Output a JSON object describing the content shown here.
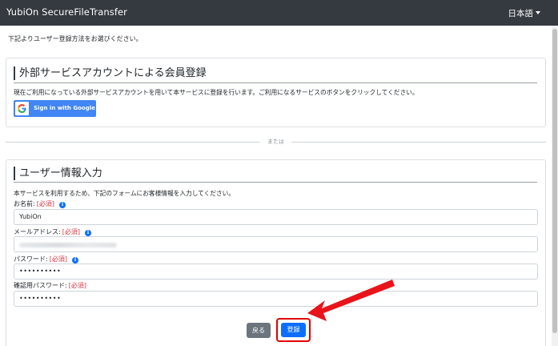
{
  "header": {
    "title": "YubiOn SecureFileTransfer",
    "language": "日本語"
  },
  "intro_text": "下記よりユーザー登録方法をお選びください。",
  "external_section": {
    "title": "外部サービスアカウントによる会員登録",
    "description": "現在ご利用になっている外部サービスアカウントを用いて本サービスに登録を行います。ご利用になるサービスのボタンをクリックしてください。",
    "google_button_label": "Sign in with Google"
  },
  "separator_text": "または",
  "user_section": {
    "title": "ユーザー情報入力",
    "description": "本サービスを利用するため、下記のフォームにお客様情報を入力してください。",
    "required_marker": "[必須]",
    "fields": [
      {
        "label": "お名前:",
        "value": "YubiOn",
        "required": true,
        "info": true
      },
      {
        "label": "メールアドレス:",
        "value": "",
        "required": true,
        "info": true
      },
      {
        "label": "パスワード:",
        "value": "••••••••••",
        "required": true,
        "info": true
      },
      {
        "label": "確認用パスワード:",
        "value": "••••••••••",
        "required": true,
        "info": false
      }
    ],
    "back_button_label": "戻る",
    "submit_button_label": "登録"
  },
  "colors": {
    "navbar": "#343a40",
    "primary": "#0d6efd",
    "google": "#4285f4",
    "secondary": "#6c757d",
    "required": "#dc3545",
    "highlight": "#e00000"
  },
  "icons": {
    "google": "google-g-icon",
    "info": "info-circle-icon",
    "dropdown": "caret-down-icon",
    "annotation": "red-arrow-annotation"
  }
}
